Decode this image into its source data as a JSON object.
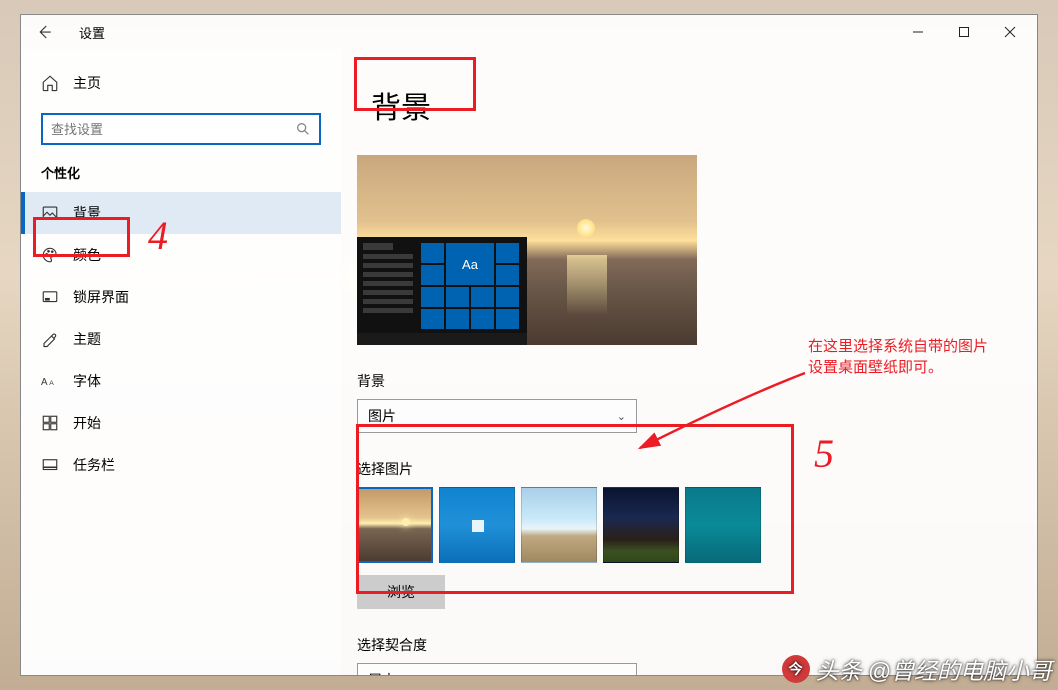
{
  "titlebar": {
    "app_title": "设置"
  },
  "sidebar": {
    "home_label": "主页",
    "search_placeholder": "查找设置",
    "section_title": "个性化",
    "items": [
      {
        "label": "背景"
      },
      {
        "label": "颜色"
      },
      {
        "label": "锁屏界面"
      },
      {
        "label": "主题"
      },
      {
        "label": "字体"
      },
      {
        "label": "开始"
      },
      {
        "label": "任务栏"
      }
    ]
  },
  "main": {
    "page_title": "背景",
    "preview_tile_text": "Aa",
    "bg_label": "背景",
    "bg_value": "图片",
    "choose_label": "选择图片",
    "browse_label": "浏览",
    "fit_label": "选择契合度",
    "fit_value": "居中"
  },
  "annotations": {
    "num4": "4",
    "num5": "5",
    "tip_line1": "在这里选择系统自带的图片",
    "tip_line2": "设置桌面壁纸即可。"
  },
  "watermark": {
    "prefix": "头条",
    "text": "@曾经的电脑小哥"
  }
}
